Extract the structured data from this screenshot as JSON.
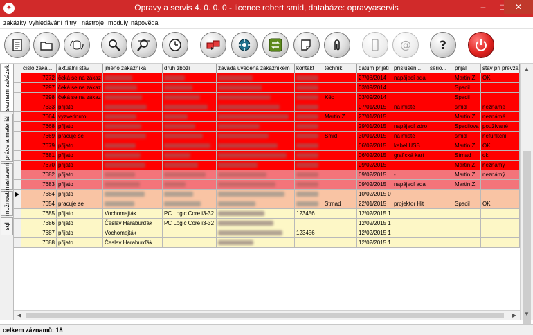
{
  "window": {
    "title": "Opravy a servis 4. 0. 0. 0 - licence robert smid, databáze: opravyaservis",
    "minimize": "–",
    "maximize": "□",
    "close": "✕",
    "app_icon": "wrench-logo-icon"
  },
  "menu": [
    "zakázky",
    "vyhledávání",
    "filtry",
    "nástroje",
    "moduly",
    "nápověda"
  ],
  "toolbar": [
    {
      "name": "orders-list-button",
      "icon": "document-list-icon",
      "disabled": false
    },
    {
      "name": "open-folder-button",
      "icon": "folder-icon",
      "disabled": false
    },
    {
      "name": "database-sync-button",
      "icon": "database-refresh-icon",
      "disabled": false
    },
    {
      "name": "search-button",
      "icon": "magnifier-icon",
      "disabled": false
    },
    {
      "name": "filter-search-button",
      "icon": "magnifier-filter-icon",
      "disabled": false
    },
    {
      "name": "history-button",
      "icon": "clock-icon",
      "disabled": false
    },
    {
      "name": "transfer-button",
      "icon": "folders-transfer-icon",
      "disabled": false
    },
    {
      "name": "network-button",
      "icon": "network-gear-icon",
      "disabled": false
    },
    {
      "name": "exchange-button",
      "icon": "exchange-arrows-icon",
      "disabled": false
    },
    {
      "name": "note-button",
      "icon": "note-pen-icon",
      "disabled": false
    },
    {
      "name": "attachment-button",
      "icon": "paperclip-icon",
      "disabled": false
    },
    {
      "name": "sms-button",
      "icon": "phone-icon",
      "disabled": true
    },
    {
      "name": "email-button",
      "icon": "at-sign-icon",
      "disabled": true
    },
    {
      "name": "help-button",
      "icon": "question-icon",
      "disabled": false
    },
    {
      "name": "exit-button",
      "icon": "power-icon",
      "disabled": false
    }
  ],
  "side_tabs": [
    "seznam zakázek",
    "práce a materiál",
    "nastavení",
    "možnosti",
    "sql"
  ],
  "columns": [
    "číslo zaká...",
    "aktuální stav",
    "jméno zákazníka",
    "druh zboží",
    "závada uvedená zákazníkem",
    "kontakt",
    "technik",
    "datum přijetí",
    "příslušen...",
    "sério...",
    "přijal",
    "stav při převze..."
  ],
  "rows": [
    {
      "id": "7272",
      "state": "čeká se na zákaz",
      "tech": "",
      "date": "27/08/2014",
      "acc": "napájecí ada",
      "serial": "",
      "recv": "Martin Z",
      "cond": "OK",
      "bg": "#ff0000"
    },
    {
      "id": "7297",
      "state": "čeká se na zákaz",
      "tech": "",
      "date": "03/09/2014",
      "acc": "",
      "serial": "",
      "recv": "Spacil",
      "cond": "",
      "bg": "#ff0000"
    },
    {
      "id": "7298",
      "state": "čeká se na zákaz",
      "tech": "Kéc",
      "date": "03/09/2014",
      "acc": "",
      "serial": "",
      "recv": "Spacil",
      "cond": "",
      "bg": "#ff0000"
    },
    {
      "id": "7633",
      "state": "přijato",
      "tech": "",
      "date": "07/01/2015",
      "acc": "na místě",
      "serial": "",
      "recv": "smid",
      "cond": "neznámé",
      "bg": "#ff0000"
    },
    {
      "id": "7664",
      "state": "vyzvednuto",
      "tech": "Martin Z",
      "date": "27/01/2015",
      "acc": "",
      "serial": "",
      "recv": "Martin Z",
      "cond": "neznámé",
      "bg": "#ff0000"
    },
    {
      "id": "7668",
      "state": "přijato",
      "tech": "",
      "date": "29/01/2015",
      "acc": "napájecí zdro",
      "serial": "",
      "recv": "Spacilova",
      "cond": "používané",
      "bg": "#ff0000"
    },
    {
      "id": "7669",
      "state": "pracuje se",
      "tech": "Smid",
      "date": "30/01/2015",
      "acc": "na místě",
      "serial": "",
      "recv": "smid",
      "cond": "nefunkční",
      "bg": "#ff0000"
    },
    {
      "id": "7679",
      "state": "přijato",
      "tech": "",
      "date": "06/02/2015",
      "acc": "kabel USB",
      "serial": "",
      "recv": "Martin Z",
      "cond": "OK",
      "bg": "#ff0000"
    },
    {
      "id": "7681",
      "state": "přijato",
      "tech": "",
      "date": "06/02/2015",
      "acc": "grafická kart",
      "serial": "",
      "recv": "Strnad",
      "cond": "ok",
      "bg": "#ff0000"
    },
    {
      "id": "7670",
      "state": "přijato",
      "tech": "",
      "date": "09/02/2015",
      "acc": "",
      "serial": "",
      "recv": "Martin Z",
      "cond": "neznámý",
      "bg": "#ff0000"
    },
    {
      "id": "7682",
      "state": "přijato",
      "tech": "",
      "date": "09/02/2015",
      "acc": "-",
      "serial": "",
      "recv": "Martin Z",
      "cond": "neznámý",
      "bg": "#f4747a"
    },
    {
      "id": "7683",
      "state": "přijato",
      "tech": "",
      "date": "09/02/2015",
      "acc": "napájecí ada",
      "serial": "",
      "recv": "Martin Z",
      "cond": "",
      "bg": "#f4747a"
    },
    {
      "id": "7684",
      "state": "přijato",
      "tech": "",
      "date": "10/02/2015 0",
      "acc": "",
      "serial": "",
      "recv": "",
      "cond": "",
      "bg": "#f9c4a4"
    },
    {
      "id": "7654",
      "state": "pracuje se",
      "tech": "Strnad",
      "date": "22/01/2015",
      "acc": "projektor Hit",
      "serial": "",
      "recv": "Spacil",
      "cond": "OK",
      "bg": "#f9c4a4"
    },
    {
      "id": "7685",
      "state": "přijato",
      "name": "Vochomejták",
      "goods": "PC Logic Core i3-32",
      "contact": "123456",
      "tech": "",
      "date": "12/02/2015 1",
      "acc": "",
      "serial": "",
      "recv": "",
      "cond": "",
      "bg": "#fdf7c6"
    },
    {
      "id": "7686",
      "state": "přijato",
      "name": "Česlav Haraburďák",
      "goods": "PC Logic Core i3-32",
      "contact": "",
      "tech": "",
      "date": "12/02/2015 1",
      "acc": "",
      "serial": "",
      "recv": "",
      "cond": "",
      "bg": "#fdf7c6"
    },
    {
      "id": "7687",
      "state": "přijato",
      "name": "Vochomejták",
      "goods": "",
      "contact": "123456",
      "tech": "",
      "date": "12/02/2015 1",
      "acc": "",
      "serial": "",
      "recv": "",
      "cond": "",
      "bg": "#fdf7c6"
    },
    {
      "id": "7688",
      "state": "přijato",
      "name": "Česlav Haraburďák",
      "goods": "",
      "contact": "",
      "tech": "",
      "date": "12/02/2015 1",
      "acc": "",
      "serial": "",
      "recv": "",
      "cond": "",
      "bg": "#fdf7c6"
    }
  ],
  "current_row_index": 12,
  "status": {
    "record_count": "celkem záznamů: 18"
  }
}
